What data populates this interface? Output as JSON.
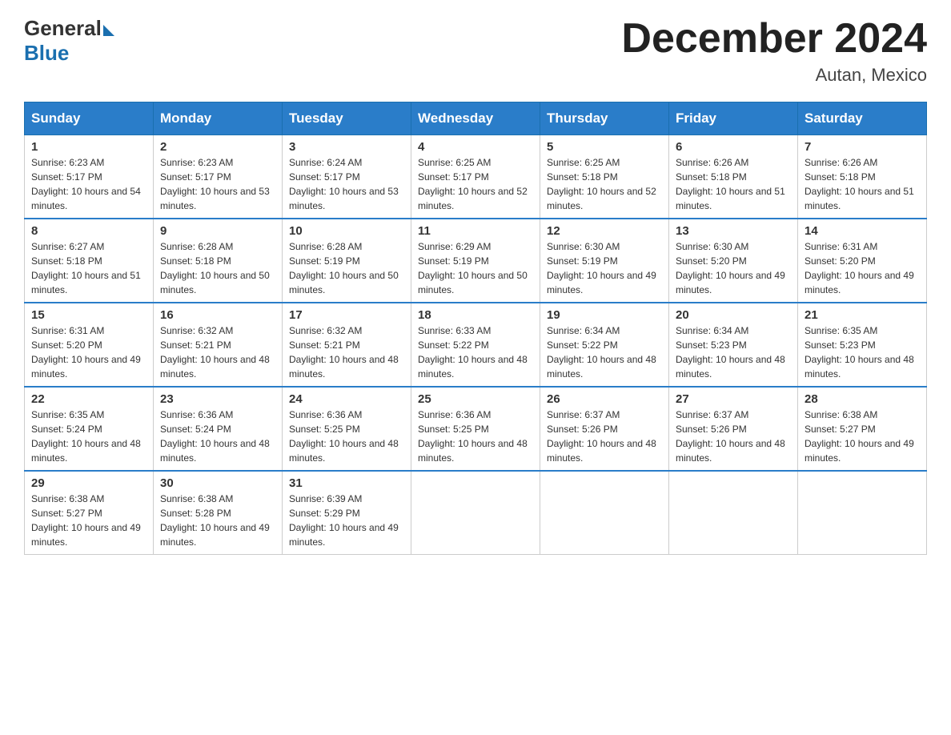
{
  "header": {
    "logo_general": "General",
    "logo_blue": "Blue",
    "title": "December 2024",
    "location": "Autan, Mexico"
  },
  "days_of_week": [
    "Sunday",
    "Monday",
    "Tuesday",
    "Wednesday",
    "Thursday",
    "Friday",
    "Saturday"
  ],
  "weeks": [
    [
      {
        "day": "1",
        "sunrise": "6:23 AM",
        "sunset": "5:17 PM",
        "daylight": "10 hours and 54 minutes."
      },
      {
        "day": "2",
        "sunrise": "6:23 AM",
        "sunset": "5:17 PM",
        "daylight": "10 hours and 53 minutes."
      },
      {
        "day": "3",
        "sunrise": "6:24 AM",
        "sunset": "5:17 PM",
        "daylight": "10 hours and 53 minutes."
      },
      {
        "day": "4",
        "sunrise": "6:25 AM",
        "sunset": "5:17 PM",
        "daylight": "10 hours and 52 minutes."
      },
      {
        "day": "5",
        "sunrise": "6:25 AM",
        "sunset": "5:18 PM",
        "daylight": "10 hours and 52 minutes."
      },
      {
        "day": "6",
        "sunrise": "6:26 AM",
        "sunset": "5:18 PM",
        "daylight": "10 hours and 51 minutes."
      },
      {
        "day": "7",
        "sunrise": "6:26 AM",
        "sunset": "5:18 PM",
        "daylight": "10 hours and 51 minutes."
      }
    ],
    [
      {
        "day": "8",
        "sunrise": "6:27 AM",
        "sunset": "5:18 PM",
        "daylight": "10 hours and 51 minutes."
      },
      {
        "day": "9",
        "sunrise": "6:28 AM",
        "sunset": "5:18 PM",
        "daylight": "10 hours and 50 minutes."
      },
      {
        "day": "10",
        "sunrise": "6:28 AM",
        "sunset": "5:19 PM",
        "daylight": "10 hours and 50 minutes."
      },
      {
        "day": "11",
        "sunrise": "6:29 AM",
        "sunset": "5:19 PM",
        "daylight": "10 hours and 50 minutes."
      },
      {
        "day": "12",
        "sunrise": "6:30 AM",
        "sunset": "5:19 PM",
        "daylight": "10 hours and 49 minutes."
      },
      {
        "day": "13",
        "sunrise": "6:30 AM",
        "sunset": "5:20 PM",
        "daylight": "10 hours and 49 minutes."
      },
      {
        "day": "14",
        "sunrise": "6:31 AM",
        "sunset": "5:20 PM",
        "daylight": "10 hours and 49 minutes."
      }
    ],
    [
      {
        "day": "15",
        "sunrise": "6:31 AM",
        "sunset": "5:20 PM",
        "daylight": "10 hours and 49 minutes."
      },
      {
        "day": "16",
        "sunrise": "6:32 AM",
        "sunset": "5:21 PM",
        "daylight": "10 hours and 48 minutes."
      },
      {
        "day": "17",
        "sunrise": "6:32 AM",
        "sunset": "5:21 PM",
        "daylight": "10 hours and 48 minutes."
      },
      {
        "day": "18",
        "sunrise": "6:33 AM",
        "sunset": "5:22 PM",
        "daylight": "10 hours and 48 minutes."
      },
      {
        "day": "19",
        "sunrise": "6:34 AM",
        "sunset": "5:22 PM",
        "daylight": "10 hours and 48 minutes."
      },
      {
        "day": "20",
        "sunrise": "6:34 AM",
        "sunset": "5:23 PM",
        "daylight": "10 hours and 48 minutes."
      },
      {
        "day": "21",
        "sunrise": "6:35 AM",
        "sunset": "5:23 PM",
        "daylight": "10 hours and 48 minutes."
      }
    ],
    [
      {
        "day": "22",
        "sunrise": "6:35 AM",
        "sunset": "5:24 PM",
        "daylight": "10 hours and 48 minutes."
      },
      {
        "day": "23",
        "sunrise": "6:36 AM",
        "sunset": "5:24 PM",
        "daylight": "10 hours and 48 minutes."
      },
      {
        "day": "24",
        "sunrise": "6:36 AM",
        "sunset": "5:25 PM",
        "daylight": "10 hours and 48 minutes."
      },
      {
        "day": "25",
        "sunrise": "6:36 AM",
        "sunset": "5:25 PM",
        "daylight": "10 hours and 48 minutes."
      },
      {
        "day": "26",
        "sunrise": "6:37 AM",
        "sunset": "5:26 PM",
        "daylight": "10 hours and 48 minutes."
      },
      {
        "day": "27",
        "sunrise": "6:37 AM",
        "sunset": "5:26 PM",
        "daylight": "10 hours and 48 minutes."
      },
      {
        "day": "28",
        "sunrise": "6:38 AM",
        "sunset": "5:27 PM",
        "daylight": "10 hours and 49 minutes."
      }
    ],
    [
      {
        "day": "29",
        "sunrise": "6:38 AM",
        "sunset": "5:27 PM",
        "daylight": "10 hours and 49 minutes."
      },
      {
        "day": "30",
        "sunrise": "6:38 AM",
        "sunset": "5:28 PM",
        "daylight": "10 hours and 49 minutes."
      },
      {
        "day": "31",
        "sunrise": "6:39 AM",
        "sunset": "5:29 PM",
        "daylight": "10 hours and 49 minutes."
      },
      null,
      null,
      null,
      null
    ]
  ]
}
